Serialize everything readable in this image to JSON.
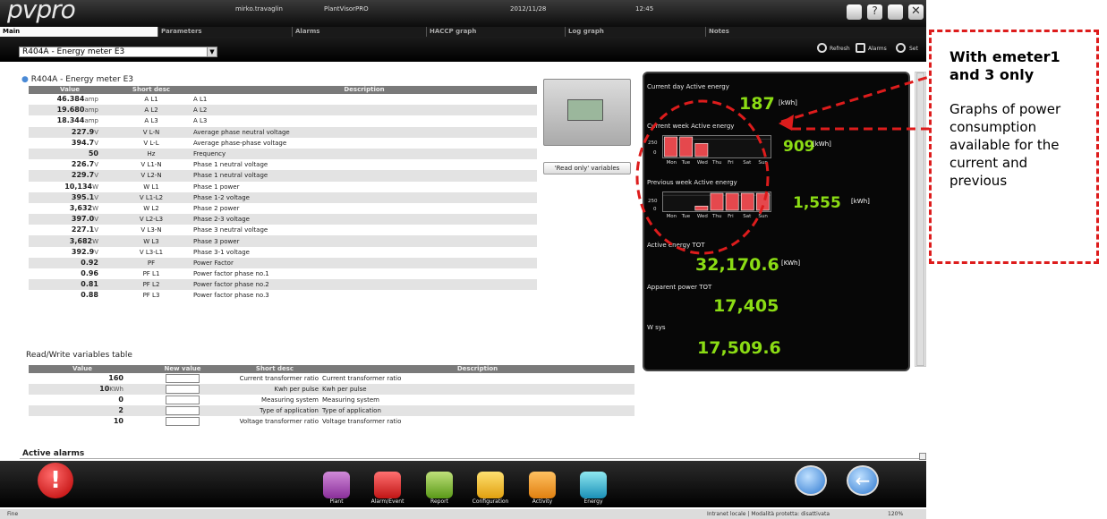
{
  "header": {
    "logo": "pvpro",
    "user": "mirko.travaglin",
    "app": "PlantVisorPRO",
    "date": "2012/11/28",
    "time": "12:45"
  },
  "tabs": [
    "Main",
    "Parameters",
    "Alarms",
    "HACCP graph",
    "Log graph",
    "Notes"
  ],
  "device_select": "R404A - Energy meter E3",
  "toolbar": {
    "refresh": "Refresh",
    "alarms": "Alarms",
    "set": "Set"
  },
  "section_title": "R404A - Energy meter E3",
  "table1": {
    "headers": [
      "Value",
      "Short desc",
      "Description"
    ],
    "rows": [
      {
        "value": "46.384",
        "unit": "amp",
        "short": "A L1",
        "desc": "A L1"
      },
      {
        "value": "19.680",
        "unit": "amp",
        "short": "A L2",
        "desc": "A L2"
      },
      {
        "value": "18.344",
        "unit": "amp",
        "short": "A L3",
        "desc": "A L3"
      },
      {
        "value": "227.9",
        "unit": "V",
        "short": "V L-N",
        "desc": "Average phase neutral voltage"
      },
      {
        "value": "394.7",
        "unit": "V",
        "short": "V L-L",
        "desc": "Average phase-phase voltage"
      },
      {
        "value": "50",
        "unit": "",
        "short": "Hz",
        "desc": "Frequency"
      },
      {
        "value": "226.7",
        "unit": "V",
        "short": "V L1-N",
        "desc": "Phase 1 neutral voltage"
      },
      {
        "value": "229.7",
        "unit": "V",
        "short": "V L2-N",
        "desc": "Phase 1 neutral voltage"
      },
      {
        "value": "10,134",
        "unit": "W",
        "short": "W L1",
        "desc": "Phase 1 power"
      },
      {
        "value": "395.1",
        "unit": "V",
        "short": "V L1-L2",
        "desc": "Phase 1-2 voltage"
      },
      {
        "value": "3,632",
        "unit": "W",
        "short": "W L2",
        "desc": "Phase 2 power"
      },
      {
        "value": "397.0",
        "unit": "V",
        "short": "V L2-L3",
        "desc": "Phase 2-3 voltage"
      },
      {
        "value": "227.1",
        "unit": "V",
        "short": "V L3-N",
        "desc": "Phase 3 neutral voltage"
      },
      {
        "value": "3,682",
        "unit": "W",
        "short": "W L3",
        "desc": "Phase 3 power"
      },
      {
        "value": "392.9",
        "unit": "V",
        "short": "V L3-L1",
        "desc": "Phase 3-1 voltage"
      },
      {
        "value": "0.92",
        "unit": "",
        "short": "PF",
        "desc": "Power Factor"
      },
      {
        "value": "0.96",
        "unit": "",
        "short": "PF L1",
        "desc": "Power factor phase no.1"
      },
      {
        "value": "0.81",
        "unit": "",
        "short": "PF L2",
        "desc": "Power factor phase no.2"
      },
      {
        "value": "0.88",
        "unit": "",
        "short": "PF L3",
        "desc": "Power factor phase no.3"
      }
    ]
  },
  "readonly_button": "'Read only' variables",
  "rw_title": "Read/Write variables table",
  "table2": {
    "headers": [
      "Value",
      "New value",
      "Short desc",
      "Description"
    ],
    "rows": [
      {
        "value": "160",
        "unit": "",
        "short": "Current transformer ratio",
        "desc": "Current transformer ratio"
      },
      {
        "value": "10",
        "unit": "KWh",
        "short": "Kwh per pulse",
        "desc": "Kwh per pulse"
      },
      {
        "value": "0",
        "unit": "",
        "short": "Measuring system",
        "desc": "Measuring system"
      },
      {
        "value": "2",
        "unit": "",
        "short": "Type of application",
        "desc": "Type of application"
      },
      {
        "value": "10",
        "unit": "",
        "short": "Voltage transformer ratio",
        "desc": "Voltage transformer ratio"
      }
    ]
  },
  "active_alarms": "Active alarms",
  "energy_panel": {
    "day_label": "Current day Active energy",
    "day_value": "187",
    "week_label": "Current week Active energy",
    "week_value": "909",
    "prev_label": "Previous week Active energy",
    "prev_value": "1,555",
    "unit": "[kWh]",
    "unit_tot": "[KWh]",
    "tot_label": "Active energy TOT",
    "tot_value": "32,170.6",
    "app_label": "Apparent power TOT",
    "app_value": "17,405",
    "wsys_label": "W sys",
    "wsys_value": "17,509.6",
    "days": [
      "Mon",
      "Tue",
      "Wed",
      "Thu",
      "Fri",
      "Sat",
      "Sun"
    ],
    "ytick_top": "250",
    "ytick_zero": "0"
  },
  "chart_data": [
    {
      "type": "bar",
      "title": "Current week Active energy",
      "categories": [
        "Mon",
        "Tue",
        "Wed",
        "Thu",
        "Fri",
        "Sat",
        "Sun"
      ],
      "values": [
        300,
        300,
        200,
        0,
        0,
        0,
        0
      ],
      "ylim": [
        0,
        300
      ]
    },
    {
      "type": "bar",
      "title": "Previous week Active energy",
      "categories": [
        "Mon",
        "Tue",
        "Wed",
        "Thu",
        "Fri",
        "Sat",
        "Sun"
      ],
      "values": [
        0,
        0,
        75,
        300,
        300,
        300,
        300
      ],
      "ylim": [
        0,
        300
      ]
    }
  ],
  "bottom_nav": [
    "Plant",
    "Alarm/Event",
    "Report",
    "Configuration",
    "Activity",
    "Energy"
  ],
  "status": {
    "left": "Fine",
    "zone": "Intranet locale | Modalità protetta: disattivata",
    "zoom": "120%"
  },
  "annotation": {
    "heading": "With emeter1 and 3 only",
    "text": "Graphs of power consumption available for the current and previous"
  },
  "colors": {
    "accent_green": "#8bdc14",
    "bar_red": "#e5484d",
    "annotation_red": "#dd1c1c"
  }
}
